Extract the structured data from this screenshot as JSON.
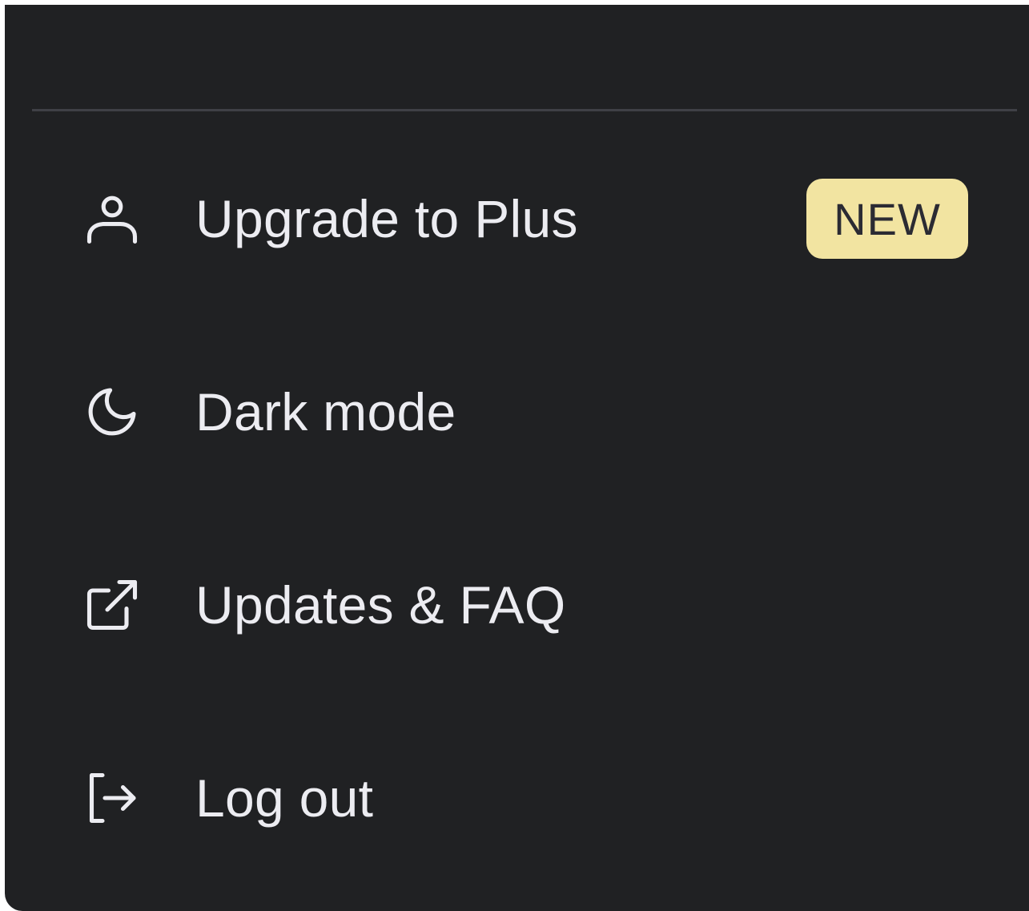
{
  "menu": {
    "items": [
      {
        "label": "Upgrade to Plus",
        "icon": "user-icon",
        "badge": "NEW"
      },
      {
        "label": "Dark mode",
        "icon": "moon-icon"
      },
      {
        "label": "Updates & FAQ",
        "icon": "external-link-icon"
      },
      {
        "label": "Log out",
        "icon": "log-out-icon"
      }
    ]
  },
  "colors": {
    "menu_background": "#202123",
    "divider": "#3f4046",
    "text": "#ececf1",
    "badge_background": "#f2e4a1",
    "badge_text": "#2b2b33"
  }
}
